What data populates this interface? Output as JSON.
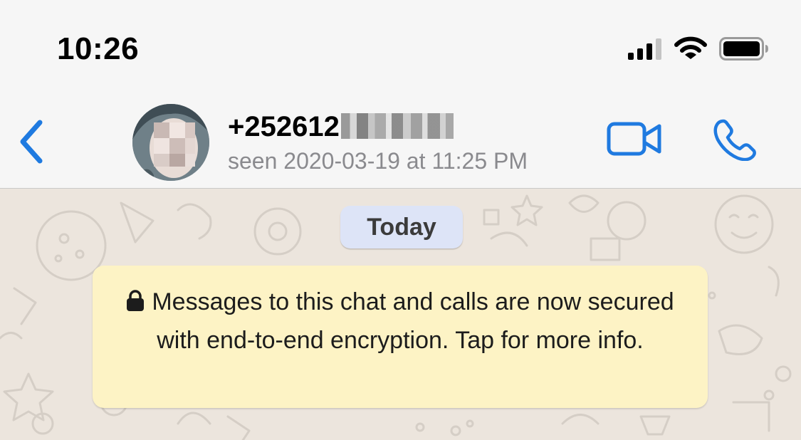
{
  "status_bar": {
    "time": "10:26",
    "icons": [
      "cellular-signal-icon",
      "wifi-icon",
      "battery-icon"
    ]
  },
  "header": {
    "back_icon": "chevron-left-icon",
    "contact_name": "+252612",
    "last_seen": "seen 2020-03-19 at 11:25 PM",
    "actions": [
      "video-camera-icon",
      "phone-icon"
    ]
  },
  "chat": {
    "date_label": "Today",
    "encryption_notice": "Messages to this chat and calls are now secured with end-to-end encryption. Tap for more info."
  },
  "colors": {
    "accent": "#1f7ae0",
    "header_bg": "#f6f6f6",
    "chat_bg": "#ece5dd",
    "date_chip_bg": "#dde4f7",
    "notice_bg": "#fdf3c5",
    "secondary_text": "#8a8a8e"
  }
}
